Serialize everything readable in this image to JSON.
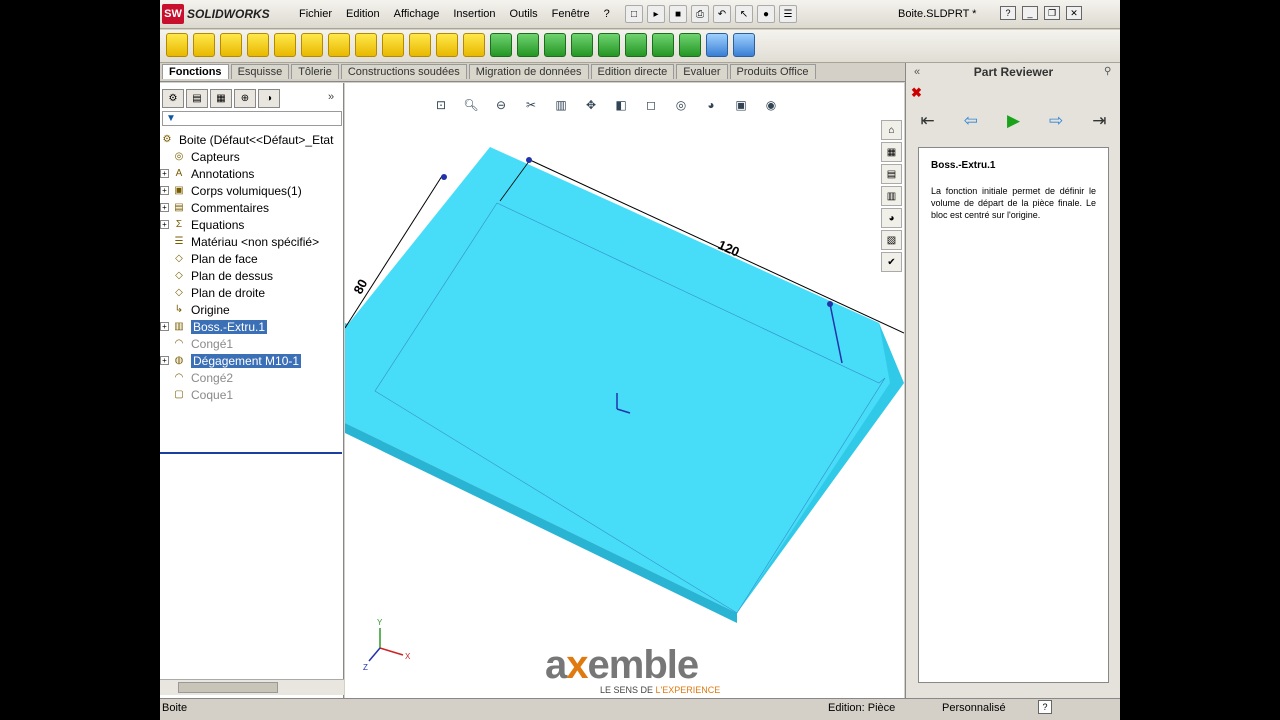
{
  "app": {
    "logo_badge": "SW",
    "brand": "SOLIDWORKS",
    "menu": [
      "Fichier",
      "Edition",
      "Affichage",
      "Insertion",
      "Outils",
      "Fenêtre",
      "?"
    ],
    "doc_title": "Boite.SLDPRT *"
  },
  "tabs": [
    "Fonctions",
    "Esquisse",
    "Tôlerie",
    "Constructions soudées",
    "Migration de données",
    "Edition directe",
    "Evaluer",
    "Produits Office"
  ],
  "tree": {
    "root": "Boite  (Défaut<<Défaut>_Etat",
    "items": [
      {
        "label": "Capteurs",
        "pm": false,
        "icon": "sensor-icon",
        "state": "normal"
      },
      {
        "label": "Annotations",
        "pm": true,
        "icon": "annotation-icon",
        "state": "normal"
      },
      {
        "label": "Corps volumiques(1)",
        "pm": true,
        "icon": "solid-bodies-icon",
        "state": "normal"
      },
      {
        "label": "Commentaires",
        "pm": true,
        "icon": "comments-icon",
        "state": "normal"
      },
      {
        "label": "Equations",
        "pm": true,
        "icon": "equations-icon",
        "state": "normal"
      },
      {
        "label": "Matériau <non spécifié>",
        "pm": false,
        "icon": "material-icon",
        "state": "normal"
      },
      {
        "label": "Plan de face",
        "pm": false,
        "icon": "plane-icon",
        "state": "normal"
      },
      {
        "label": "Plan de dessus",
        "pm": false,
        "icon": "plane-icon",
        "state": "normal"
      },
      {
        "label": "Plan de droite",
        "pm": false,
        "icon": "plane-icon",
        "state": "normal"
      },
      {
        "label": "Origine",
        "pm": false,
        "icon": "origin-icon",
        "state": "normal"
      },
      {
        "label": "Boss.-Extru.1",
        "pm": true,
        "icon": "extrude-icon",
        "state": "selected"
      },
      {
        "label": "Congé1",
        "pm": false,
        "icon": "fillet-icon",
        "state": "dim"
      },
      {
        "label": "Dégagement M10-1",
        "pm": true,
        "icon": "hole-icon",
        "state": "selected"
      },
      {
        "label": "Congé2",
        "pm": false,
        "icon": "fillet-icon",
        "state": "dim"
      },
      {
        "label": "Coque1",
        "pm": false,
        "icon": "shell-icon",
        "state": "dim"
      }
    ]
  },
  "viewport": {
    "dim_120": "120",
    "dim_80": "80",
    "model_color": "#3fe0f5",
    "logo_text_a": "a",
    "logo_text_x": "x",
    "logo_text_rest": "emble",
    "tagline_a": "LE SENS DE ",
    "tagline_b": "L'EXPERIENCE"
  },
  "part_reviewer": {
    "title": "Part Reviewer",
    "close": "✖",
    "step_title": "Boss.-Extru.1",
    "step_text": "La fonction initiale permet de définir le volume de départ de la pièce finale. Le bloc est centré sur l'origine."
  },
  "status": {
    "left": "Boite",
    "edition": "Edition: Pièce",
    "custom": "Personnalisé",
    "help": "?"
  }
}
